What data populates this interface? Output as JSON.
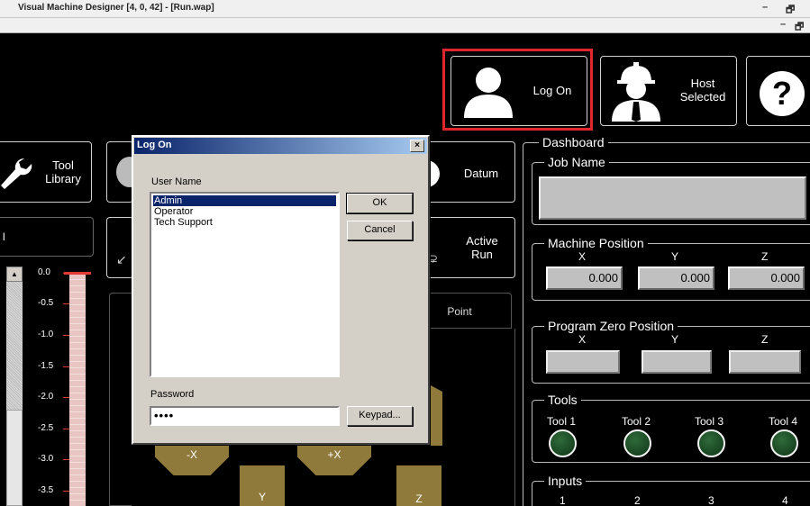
{
  "window": {
    "title": "Visual Machine Designer [4, 0, 42] - [Run.wap]",
    "min_glyph": "–",
    "restore_glyph": "🗗",
    "close_glyph": "×"
  },
  "toolbar": {
    "log_on_label": "Log On",
    "host_selected_label": "Host\nSelected",
    "help_glyph": "?"
  },
  "left_panel": {
    "tool_library_label": "Tool\nLibrary",
    "tab_fragment": "l",
    "datum_label": "Datum",
    "active_run_label": "Active\nRun",
    "point_tab_label": "Point",
    "scale_ticks": [
      "0.0",
      "-0.5",
      "-1.0",
      "-1.5",
      "-2.0",
      "-2.5",
      "-3.0",
      "-3.5"
    ]
  },
  "jog": {
    "minus_x": "-X",
    "plus_x": "+X",
    "y": "Y",
    "z": "Z"
  },
  "dashboard": {
    "title": "Dashboard",
    "job_name_label": "Job Name",
    "job_name_value": "",
    "machine_position": {
      "label": "Machine Position",
      "axes": [
        "X",
        "Y",
        "Z"
      ],
      "values": [
        "0.000",
        "0.000",
        "0.000"
      ]
    },
    "program_zero": {
      "label": "Program Zero Position",
      "axes": [
        "X",
        "Y",
        "Z"
      ]
    },
    "tools": {
      "label": "Tools",
      "items": [
        "Tool 1",
        "Tool 2",
        "Tool 3",
        "Tool 4"
      ]
    },
    "inputs": {
      "label": "Inputs",
      "items": [
        "1",
        "2",
        "3",
        "4"
      ]
    }
  },
  "dialog": {
    "title": "Log On",
    "user_name_label": "User Name",
    "users": [
      "Admin",
      "Operator",
      "Tech Support"
    ],
    "selected_user": "Admin",
    "ok_label": "OK",
    "cancel_label": "Cancel",
    "password_label": "Password",
    "password_value": "••••",
    "keypad_label": "Keypad..."
  },
  "colors": {
    "highlight_frame": "#e0252c",
    "jog_button": "#8f7a3c",
    "led_off": "#1c4a26",
    "dialog_title": "#0a246a"
  }
}
